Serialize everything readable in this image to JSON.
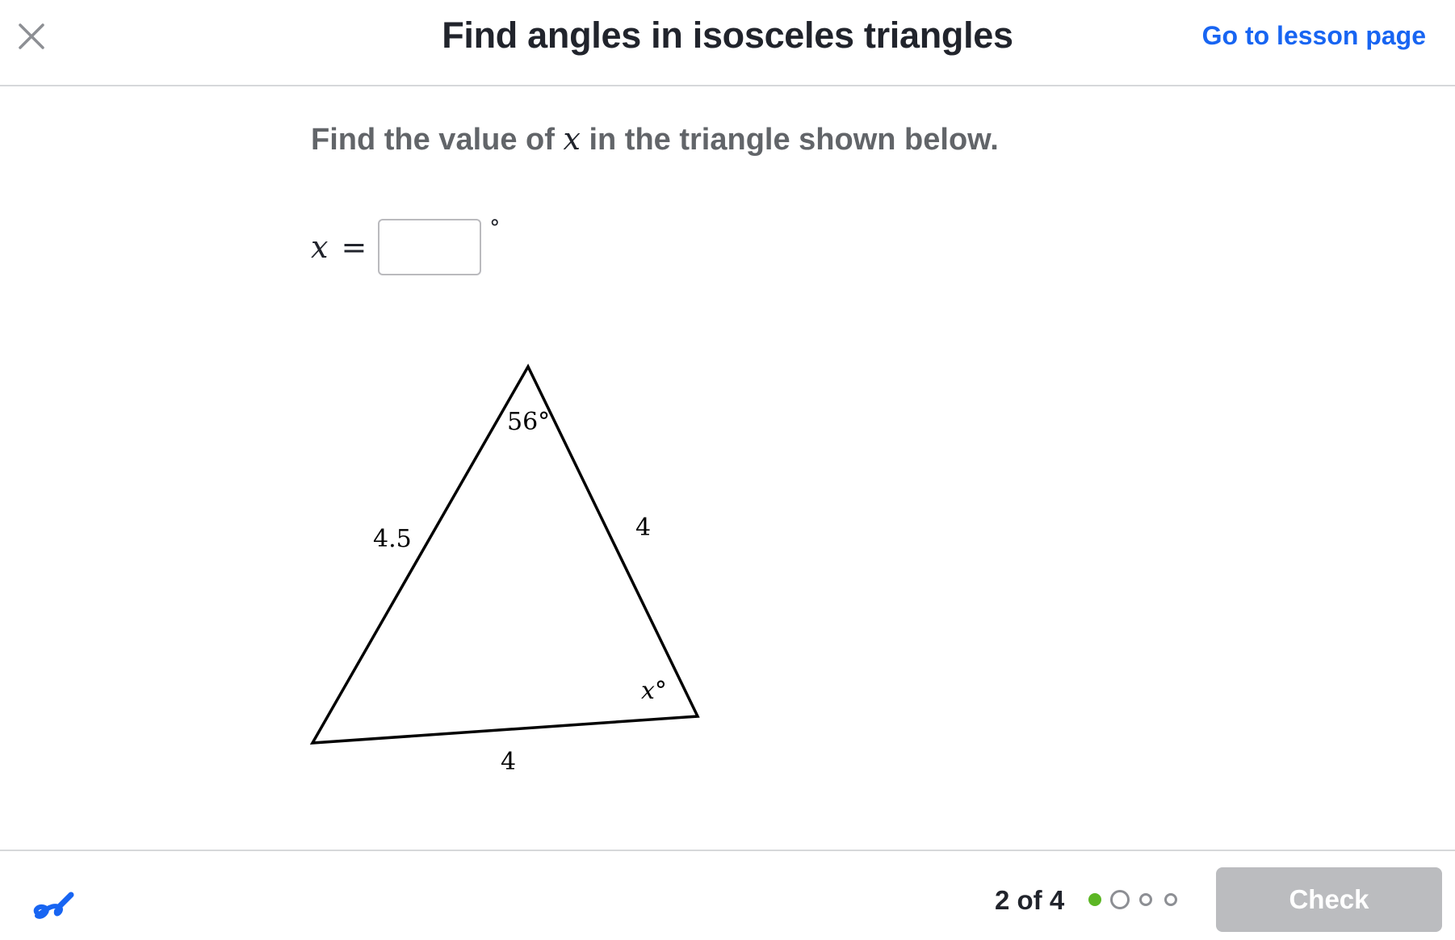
{
  "header": {
    "title": "Find angles in isosceles triangles",
    "lesson_link": "Go to lesson page"
  },
  "question": {
    "prompt_before": "Find the value of ",
    "prompt_var": "x",
    "prompt_after": " in the triangle shown below.",
    "answer_var": "x",
    "answer_eq": "=",
    "answer_value": "",
    "answer_unit": "°"
  },
  "diagram": {
    "top_angle": "56°",
    "right_angle": "x°",
    "left_side": "4.5",
    "right_side": "4",
    "bottom_side": "4"
  },
  "footer": {
    "progress": "2 of 4",
    "current_step": 2,
    "total_steps": 4,
    "completed_step": 1,
    "check_label": "Check"
  },
  "colors": {
    "link": "#1865f2",
    "completed_dot": "#5cb624",
    "disabled_button": "#bbbcbf",
    "scratchpad": "#1865f2"
  },
  "icons": {
    "close": "close-icon",
    "scratchpad": "scratchpad-pen-icon"
  }
}
